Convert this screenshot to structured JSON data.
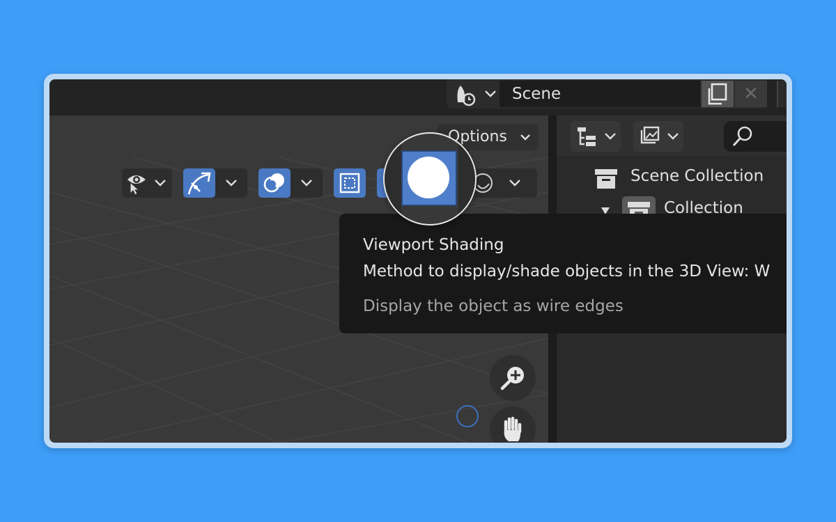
{
  "header": {
    "scene_label": "Scene"
  },
  "viewport": {
    "options_label": "Options",
    "zoom_tool": "zoom-in-icon",
    "pan_tool": "hand-icon"
  },
  "tooltip": {
    "title": "Viewport Shading",
    "description": "Method to display/shade objects in the 3D View:  W",
    "subtitle": "Display the object as wire edges"
  },
  "outliner": {
    "items": [
      {
        "label": "Scene Collection"
      },
      {
        "label": "Collection"
      }
    ]
  },
  "colors": {
    "background": "#3d9df7",
    "accent": "#4a79c3"
  }
}
